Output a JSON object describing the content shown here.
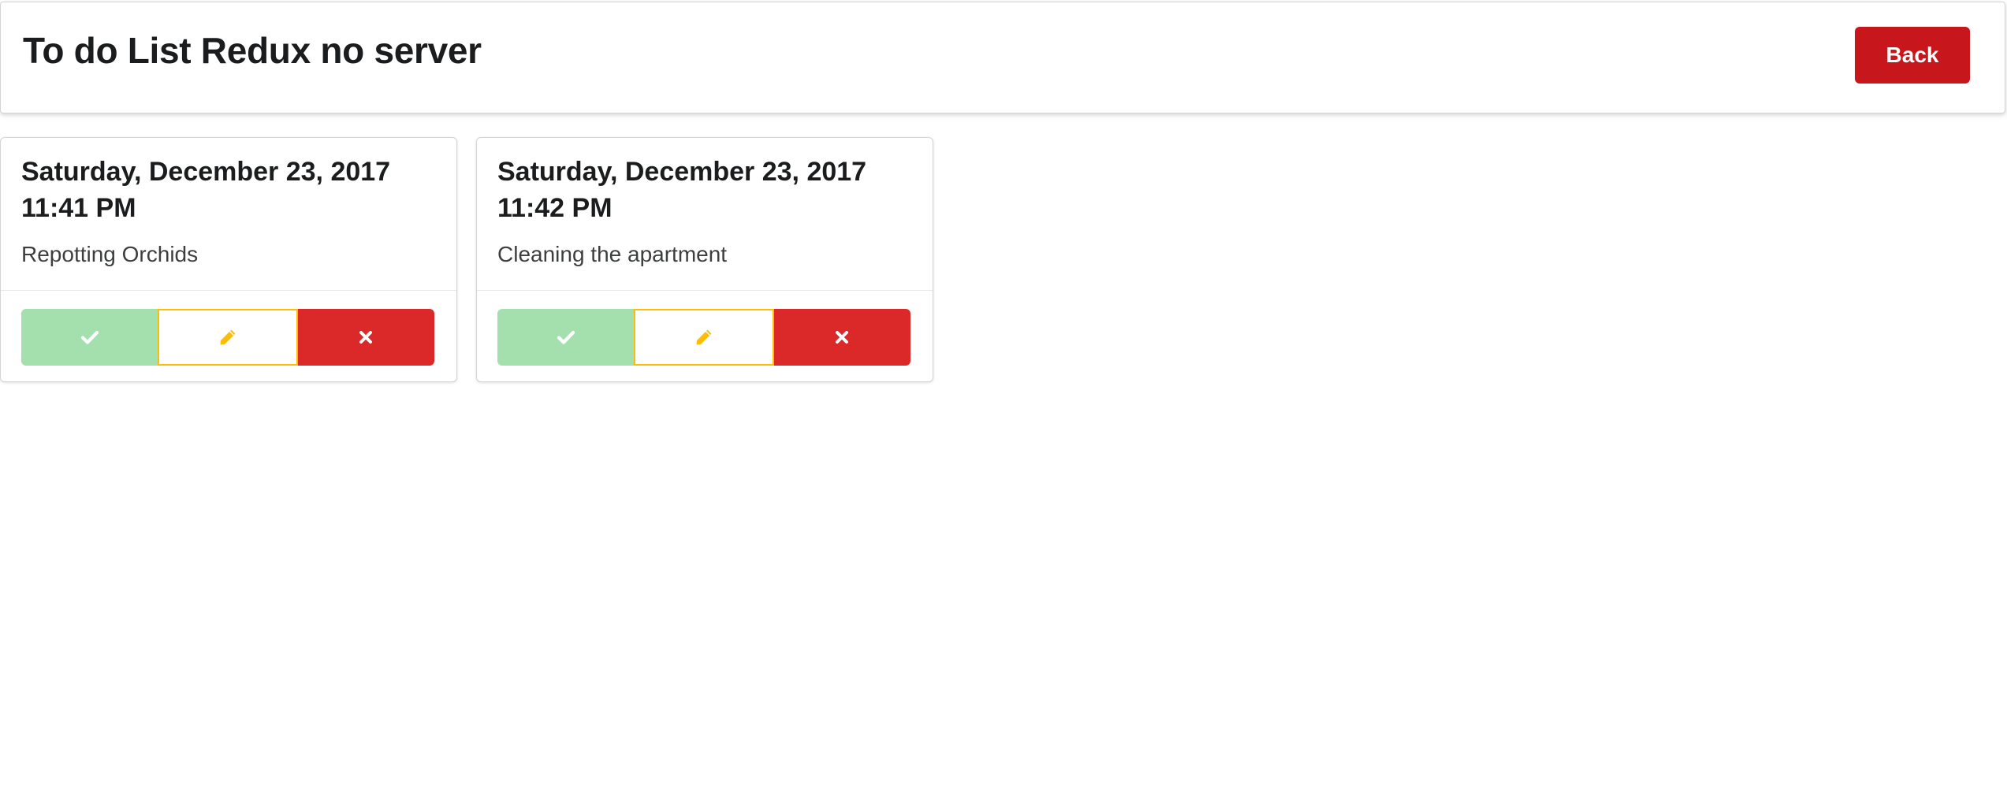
{
  "header": {
    "title": "To do List Redux no server",
    "back_label": "Back"
  },
  "todos": [
    {
      "date": "Saturday, December 23, 2017",
      "time": "11:41 PM",
      "text": "Repotting Orchids",
      "actions": {
        "complete_icon": "check-icon",
        "edit_icon": "pencil-icon",
        "delete_icon": "close-icon"
      }
    },
    {
      "date": "Saturday, December 23, 2017",
      "time": "11:42 PM",
      "text": "Cleaning the apartment",
      "actions": {
        "complete_icon": "check-icon",
        "edit_icon": "pencil-icon",
        "delete_icon": "close-icon"
      }
    }
  ],
  "colors": {
    "back_button": "#c8161d",
    "complete": "#a3e0ad",
    "edit_border": "#fbbd08",
    "delete": "#db2828"
  }
}
